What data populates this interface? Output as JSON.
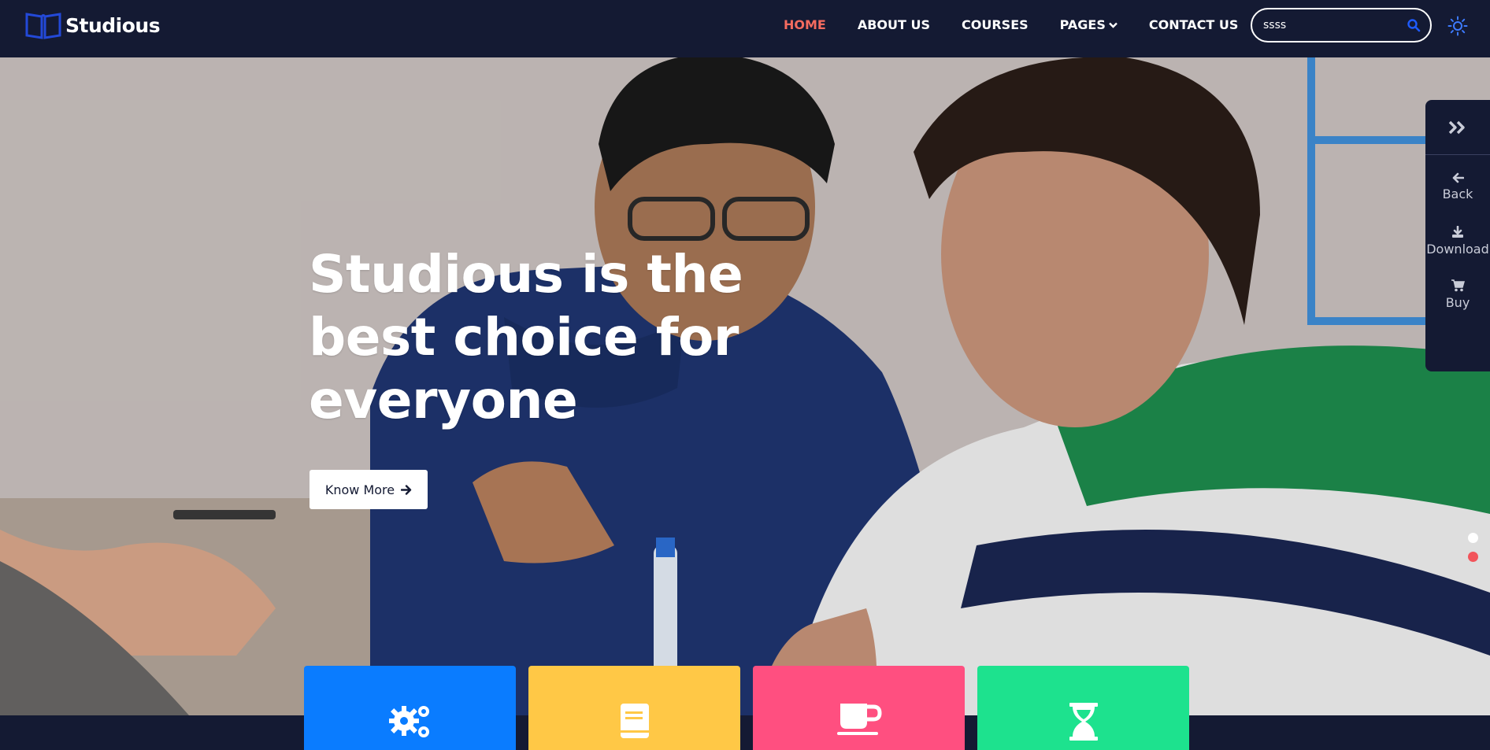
{
  "brand": {
    "name": "Studious",
    "logo_icon": "open-book-icon"
  },
  "nav": {
    "items": [
      {
        "label": "HOME",
        "active": true
      },
      {
        "label": "ABOUT US",
        "active": false
      },
      {
        "label": "COURSES",
        "active": false
      },
      {
        "label": "PAGES",
        "active": false,
        "has_dropdown": true
      },
      {
        "label": "CONTACT US",
        "active": false
      }
    ]
  },
  "search": {
    "value": "ssss",
    "icon": "search-icon"
  },
  "theme_toggle": {
    "icon": "sun-icon"
  },
  "hero": {
    "title": "Studious is the best choice for everyone",
    "cta_label": "Know More",
    "cta_icon": "arrow-right-icon"
  },
  "side_panel": {
    "toggle_icon": "double-chevron-right-icon",
    "items": [
      {
        "label": "Back",
        "icon": "arrow-left-icon"
      },
      {
        "label": "Download",
        "icon": "download-icon"
      },
      {
        "label": "Buy",
        "icon": "cart-icon"
      }
    ]
  },
  "slider": {
    "dots": [
      {
        "active": false
      },
      {
        "active": true
      }
    ]
  },
  "feature_cards": [
    {
      "icon": "gears-icon",
      "color": "#0a7cff"
    },
    {
      "icon": "book-icon",
      "color": "#ffc846"
    },
    {
      "icon": "coffee-cup-icon",
      "color": "#ff4f80"
    },
    {
      "icon": "hourglass-icon",
      "color": "#1de28e"
    }
  ],
  "colors": {
    "header_bg": "#141a33",
    "accent_active": "#f46b5f",
    "search_icon": "#1e5bff",
    "dot_active": "#f2545b",
    "dot_inactive": "#ffffff"
  }
}
